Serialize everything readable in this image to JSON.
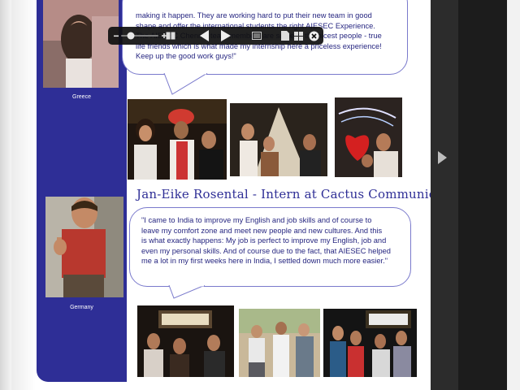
{
  "testimonials": [
    {
      "country": "Greece",
      "quote_lines": [
        "making it happen. They are working hard to put their new team in good",
        "shape and offer the international students the right AIESEC Experience.",
        "The AIESEC Chennai team members are some of the nicest people - true",
        "life friends which is what made my internship here a priceless experience!",
        "Keep up the good work guys!\""
      ]
    },
    {
      "heading": "Jan-Eike Rosental - Intern at Cactus Communication",
      "country": "Germany",
      "quote_lines": [
        "\"I came to India to improve my English and job skills and of course to",
        "leave my comfort zone and meet new people and new cultures. And this",
        "is what exactly happens: My job is perfect to improve my English, job and",
        "even my personal skills. And of course due to the fact, that AIESEC helped",
        "me a lot in my first weeks here in India, I settled down much more easier.\""
      ]
    }
  ],
  "viewer_toolbar": {
    "icons": [
      "zoom-out-icon",
      "zoom-slider",
      "zoom-in-icon",
      "two-page-icon",
      "previous-page-icon",
      "next-page-icon",
      "fullscreen-icon",
      "document-icon",
      "tile-icon",
      "close-icon"
    ]
  },
  "colors": {
    "band_blue": "#2e2e96",
    "text_blue": "#262680",
    "toolbar_bg": "#0f0f0f"
  }
}
